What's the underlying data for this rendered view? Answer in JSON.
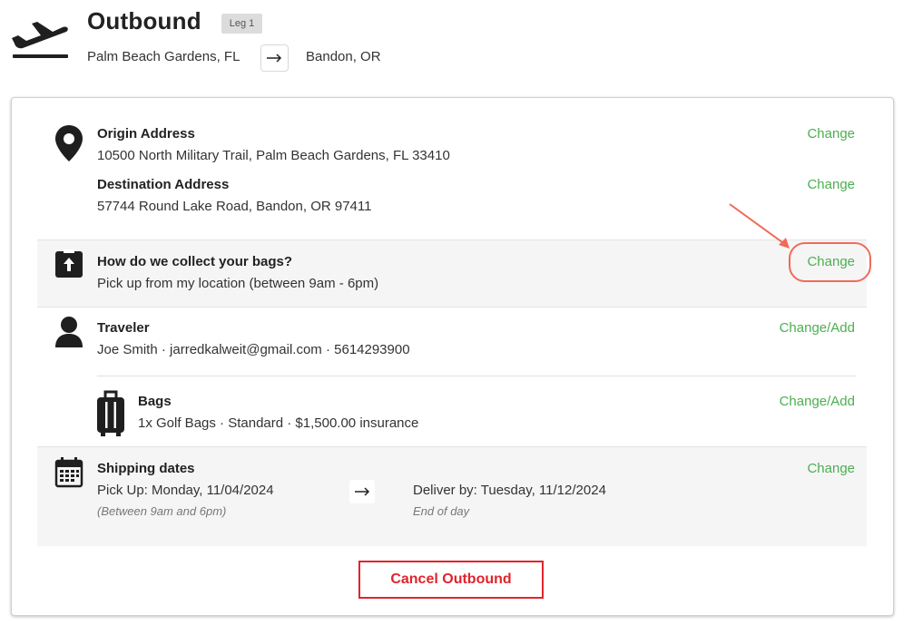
{
  "header": {
    "title": "Outbound",
    "leg_badge": "Leg 1",
    "origin_city": "Palm Beach Gardens, FL",
    "destination_city": "Bandon, OR"
  },
  "origin": {
    "label": "Origin Address",
    "value": "10500 North Military Trail, Palm Beach Gardens, FL 33410",
    "action": "Change"
  },
  "destination": {
    "label": "Destination Address",
    "value": "57744 Round Lake Road, Bandon, OR 97411",
    "action": "Change"
  },
  "collection": {
    "label": "How do we collect your bags?",
    "value": "Pick up from my location (between 9am - 6pm)",
    "action": "Change"
  },
  "traveler": {
    "label": "Traveler",
    "value": "Joe Smith · jarredkalweit@gmail.com · 5614293900",
    "action": "Change/Add"
  },
  "bags": {
    "label": "Bags",
    "value": "1x Golf Bags · Standard · $1,500.00 insurance",
    "action": "Change/Add"
  },
  "shipping": {
    "label": "Shipping dates",
    "pickup": "Pick Up: Monday, 11/04/2024",
    "pickup_note": "(Between 9am and 6pm)",
    "deliver": "Deliver by: Tuesday, 11/12/2024",
    "deliver_note": "End of day",
    "action": "Change"
  },
  "cancel_label": "Cancel Outbound",
  "colors": {
    "accent_green": "#4caf50",
    "cancel_red": "#e0242c",
    "annotation_red": "#f06a5a",
    "band_gray": "#f5f5f5"
  },
  "icons": [
    "plane-departure-icon",
    "right-arrow-icon",
    "map-pin-icon",
    "bag-upload-icon",
    "user-icon",
    "suitcase-icon",
    "calendar-icon"
  ]
}
